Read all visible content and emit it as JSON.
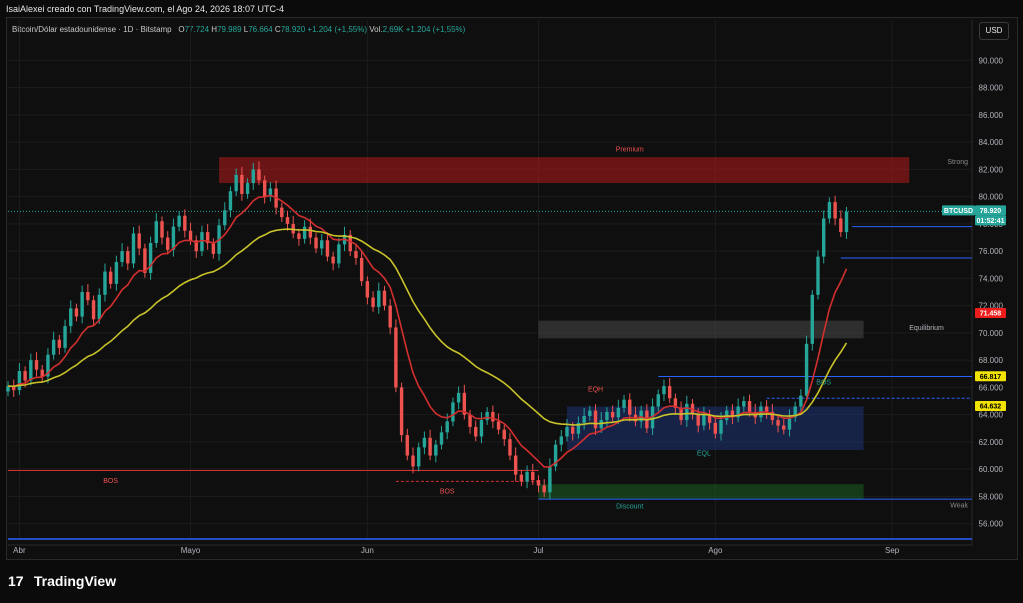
{
  "header": {
    "title": "IsaiAlexei creado con TradingView.com, el Ago 24, 2026 18:07 UTC-4"
  },
  "symbol": {
    "name": "Bitcoin/Dólar estadounidense · 1D · Bitstamp",
    "open_label": "O",
    "open": "77.724",
    "high_label": "H",
    "high": "79.989",
    "low_label": "L",
    "low": "76.664",
    "close_label": "C",
    "close": "78.920",
    "change": "+1.204 (+1,55%)",
    "vol_label": "Vol.",
    "vol": "2,69K",
    "vol_change": "+1.204 (+1,55%)"
  },
  "currency_button": "USD",
  "brand": {
    "name": "TradingView",
    "logo": "17"
  },
  "colors": {
    "up": "#26a69a",
    "down": "#ef5350",
    "ema_fast": "#d32f2f",
    "ema_slow": "#c9c32a",
    "premium": "#b71c1c",
    "discount": "#1b5e20",
    "fvg": "#1e3a8a",
    "level": "#2962ff"
  },
  "chart_data": {
    "type": "candlestick",
    "ylim": [
      54.8,
      91.5
    ],
    "yticks": [
      "56.000",
      "58.000",
      "60.000",
      "62.000",
      "64.000",
      "66.000",
      "68.000",
      "70.000",
      "72.000",
      "74.000",
      "76.000",
      "78.000",
      "80.000",
      "82.000",
      "84.000",
      "86.000",
      "88.000",
      "90.000"
    ],
    "ytick_values": [
      56,
      58,
      60,
      62,
      64,
      66,
      68,
      70,
      72,
      74,
      76,
      78,
      80,
      82,
      84,
      86,
      88,
      90
    ],
    "x_months": [
      "Abr",
      "Mayo",
      "Jun",
      "Jul",
      "Ago",
      "Sep"
    ],
    "x_month_days": [
      2,
      32,
      63,
      93,
      124,
      155
    ],
    "x_range": [
      0,
      169
    ],
    "closes": [
      66.1,
      65.8,
      67.2,
      66.5,
      68.0,
      67.3,
      66.8,
      68.4,
      69.5,
      68.9,
      70.5,
      71.8,
      71.2,
      73.0,
      72.4,
      71.0,
      72.8,
      74.5,
      73.6,
      75.2,
      76.0,
      75.1,
      77.3,
      76.2,
      74.4,
      76.6,
      78.2,
      77.0,
      76.1,
      77.8,
      78.6,
      77.5,
      76.8,
      76.0,
      77.4,
      76.6,
      75.8,
      77.9,
      79.0,
      80.4,
      81.6,
      80.2,
      81.0,
      82.0,
      81.2,
      80.0,
      80.6,
      79.2,
      78.5,
      78.0,
      77.3,
      76.9,
      77.8,
      77.0,
      76.2,
      76.8,
      75.6,
      75.1,
      76.5,
      77.2,
      76.0,
      75.5,
      73.8,
      72.6,
      71.9,
      73.1,
      72.0,
      70.4,
      66.0,
      62.5,
      61.0,
      60.2,
      61.6,
      62.3,
      61.0,
      61.8,
      62.7,
      63.5,
      64.9,
      65.6,
      64.0,
      63.1,
      62.4,
      63.6,
      64.2,
      63.5,
      62.9,
      62.2,
      61.0,
      59.6,
      59.1,
      59.8,
      59.2,
      58.8,
      58.3,
      60.2,
      61.8,
      62.4,
      63.1,
      62.6,
      63.4,
      63.9,
      64.3,
      63.0,
      63.6,
      64.2,
      63.8,
      64.5,
      65.1,
      64.0,
      63.5,
      64.3,
      63.0,
      64.6,
      65.5,
      66.1,
      65.2,
      64.5,
      63.6,
      64.8,
      64.0,
      63.2,
      64.0,
      63.4,
      62.6,
      63.6,
      64.3,
      63.8,
      64.6,
      65.0,
      64.2,
      63.8,
      64.6,
      64.2,
      63.6,
      63.2,
      62.9,
      63.8,
      64.6,
      65.4,
      69.2,
      72.8,
      75.6,
      78.4,
      79.6,
      78.4,
      77.4,
      78.9
    ],
    "annotations": {
      "premium": "Premium",
      "discount": "Discount",
      "equilibrium": "Equilibrium",
      "bos_left": "BOS",
      "bos_mid": "BOS",
      "bos_right": "BOS",
      "eqh": "EQH",
      "eql": "EQL",
      "strong_high": "Strong",
      "weak_low": "Weak"
    },
    "price_labels": [
      {
        "text": "BTCUSD",
        "value": 78.92,
        "color": "#26a69a"
      },
      {
        "text": "78.920",
        "value": 78.92,
        "color": "#26a69a"
      },
      {
        "text": "01:52:41",
        "value": 78.92,
        "color": "#26a69a"
      },
      {
        "text": "71.458",
        "value": 71.458,
        "color": "#ef1c1c"
      },
      {
        "text": "66.817",
        "value": 66.817,
        "color": "#f2e300"
      },
      {
        "text": "64.632",
        "value": 64.632,
        "color": "#f2e300"
      }
    ],
    "zones": {
      "premium_zone": [
        81.0,
        82.9
      ],
      "equilibrium_zone": [
        69.6,
        70.9
      ],
      "discount_zone": [
        57.8,
        58.9
      ],
      "fvg_zone": [
        61.4,
        64.6
      ]
    },
    "levels": {
      "bos_left_level": 59.9,
      "eqh_level": 66.8,
      "bos_right_level": 65.2,
      "discount_level": 57.8,
      "level_upper": 77.8,
      "level_mid": 75.5
    }
  }
}
